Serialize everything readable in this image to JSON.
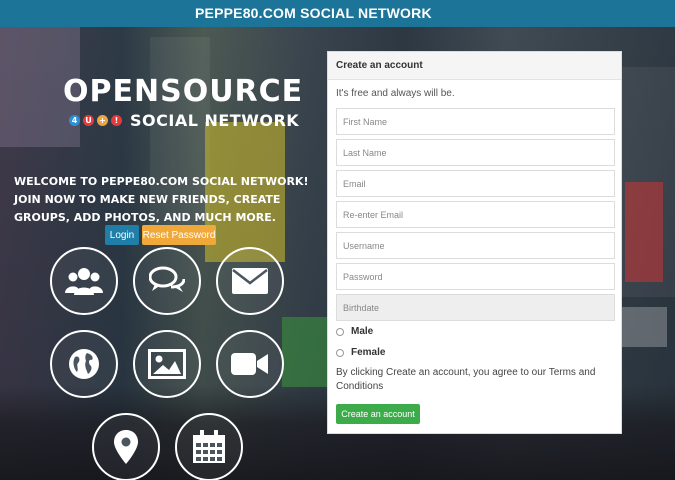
{
  "header": {
    "title": "PEPPE80.COM SOCIAL NETWORK"
  },
  "logo": {
    "top": "OPENSOURCE",
    "badges": [
      "4",
      "U",
      "+",
      "!"
    ],
    "badge_colors": [
      "#2d8fd6",
      "#e33b3b",
      "#f2a33a",
      "#e33b3b"
    ],
    "bottom": "SOCIAL NETWORK"
  },
  "welcome": {
    "text": "WELCOME TO PEPPE80.COM SOCIAL NETWORK! JOIN NOW TO MAKE NEW FRIENDS, CREATE GROUPS, ADD PHOTOS, AND MUCH MORE."
  },
  "buttons": {
    "login": "Login",
    "reset_password": "Reset Password"
  },
  "features": [
    {
      "icon": "users-icon"
    },
    {
      "icon": "chat-icon"
    },
    {
      "icon": "envelope-icon"
    },
    {
      "icon": "globe-icon"
    },
    {
      "icon": "image-icon"
    },
    {
      "icon": "video-camera-icon"
    },
    {
      "icon": "map-pin-icon"
    },
    {
      "icon": "calendar-icon"
    }
  ],
  "form": {
    "title": "Create an account",
    "tagline": "It's free and always will be.",
    "first_name": "First Name",
    "last_name": "Last Name",
    "email": "Email",
    "reenter_email": "Re-enter Email",
    "username": "Username",
    "password": "Password",
    "birthdate": "Birthdate",
    "gender_male": "Male",
    "gender_female": "Female",
    "terms": "By clicking Create an account, you agree to our Terms and Conditions",
    "submit": "Create an account"
  },
  "colors": {
    "header_bg": "#1d7499",
    "login_bg": "#1f7fa8",
    "reset_bg": "#f0a83a",
    "submit_bg": "#3cac4a"
  }
}
